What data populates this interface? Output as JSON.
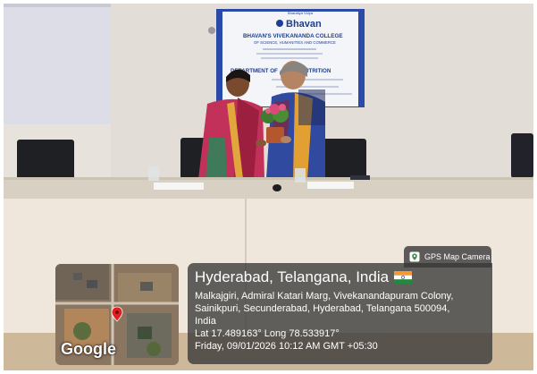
{
  "banner": {
    "publisher_tag": "Bharatiya Vidya",
    "brand": "Bhavan",
    "college_name": "BHAVAN'S VIVEKANANDA COLLEGE",
    "college_subtitle": "OF SCIENCE, HUMANITIES AND COMMERCE",
    "department": "DEPARTMENT OF … RY & NUTRITION"
  },
  "table_labels": [
    "",
    ""
  ],
  "camera_badge": {
    "icon": "gps-map-camera-icon",
    "label": "GPS Map Camera"
  },
  "map": {
    "logo": "Google",
    "pin_color": "#e02020"
  },
  "location": {
    "title": "Hyderabad, Telangana, India",
    "flag_icon": "india-flag-icon",
    "address_line_1": "Malkajgiri, Admiral Katari Marg, Vivekanandapuram Colony,",
    "address_line_2": "Sainikpuri, Secunderabad, Hyderabad, Telangana 500094,",
    "address_line_3": "India",
    "coordinates": "Lat 17.489163° Long 78.533917°",
    "datetime": "Friday, 09/01/2026 10:12 AM GMT +05:30"
  }
}
